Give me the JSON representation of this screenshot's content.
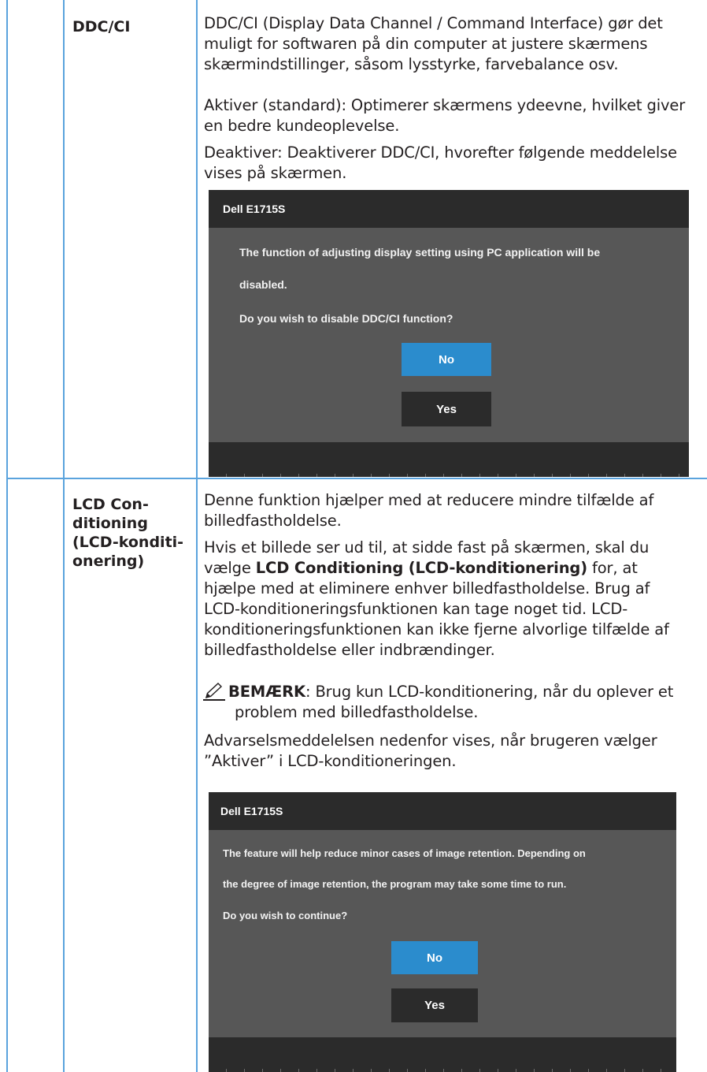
{
  "rows": [
    {
      "label_lines": [
        "DDC/CI"
      ],
      "paragraphs": [
        [
          "DDC/CI (Display Data Channel / Command Interface) gør det",
          "muligt for softwaren på din computer at justere skærmens",
          "skærmindstillinger, såsom lysstyrke, farvebalance osv."
        ],
        [
          "Aktiver (standard): Optimerer skærmens ydeevne, hvilket giver",
          "en bedre kundeoplevelse."
        ],
        [
          "Deaktiver: Deaktiverer DDC/CI, hvorefter følgende meddelelse",
          "vises på skærmen."
        ]
      ],
      "dialog": {
        "title": "Dell E1715S",
        "lines": [
          "The function of adjusting display setting using PC application will be",
          "disabled.",
          "Do you wish to disable DDC/CI function?"
        ],
        "no_label": "No",
        "yes_label": "Yes"
      }
    },
    {
      "label_lines": [
        "LCD Con-",
        "ditioning",
        "(LCD-konditi-",
        "onering)"
      ],
      "paragraphs": [
        [
          "Denne funktion hjælper med at reducere mindre tilfælde af",
          "billedfastholdelse."
        ],
        [
          "Hvis et billede ser ud til, at sidde fast på skærmen, skal du"
        ],
        [
          "LCD-konditioneringsfunktionen kan tage noget tid. LCD-",
          "konditioneringsfunktionen kan ikke fjerne alvorlige tilfælde af",
          "billedfastholdelse eller indbrændinger."
        ],
        [
          "Advarselsmeddelelsen nedenfor vises, når brugeren vælger",
          "”Aktiver” i LCD-konditioneringen."
        ]
      ],
      "inline": {
        "pre": "vælge ",
        "bold": "LCD Conditioning (LCD-konditionering)",
        "post": " for, at",
        "next": "hjælpe med at eliminere enhver billedfastholdelse. Brug af"
      },
      "note": {
        "label": "BEMÆRK",
        "text": ": Brug kun LCD-konditionering, når du oplever et",
        "text2": "problem med billedfastholdelse."
      },
      "dialog": {
        "title": "Dell E1715S",
        "lines": [
          "The feature will help reduce minor cases of image retention. Depending on",
          "the degree of image retention, the program may take some time to run.",
          "Do you wish to continue?"
        ],
        "no_label": "No",
        "yes_label": "Yes"
      }
    }
  ],
  "colors": {
    "rule": "#5aa3dd",
    "no_button": "#2b8ccd",
    "dialog_body": "#575757",
    "dialog_bar": "#2b2b2b"
  },
  "icons": {
    "note": "pencil-note-icon"
  }
}
